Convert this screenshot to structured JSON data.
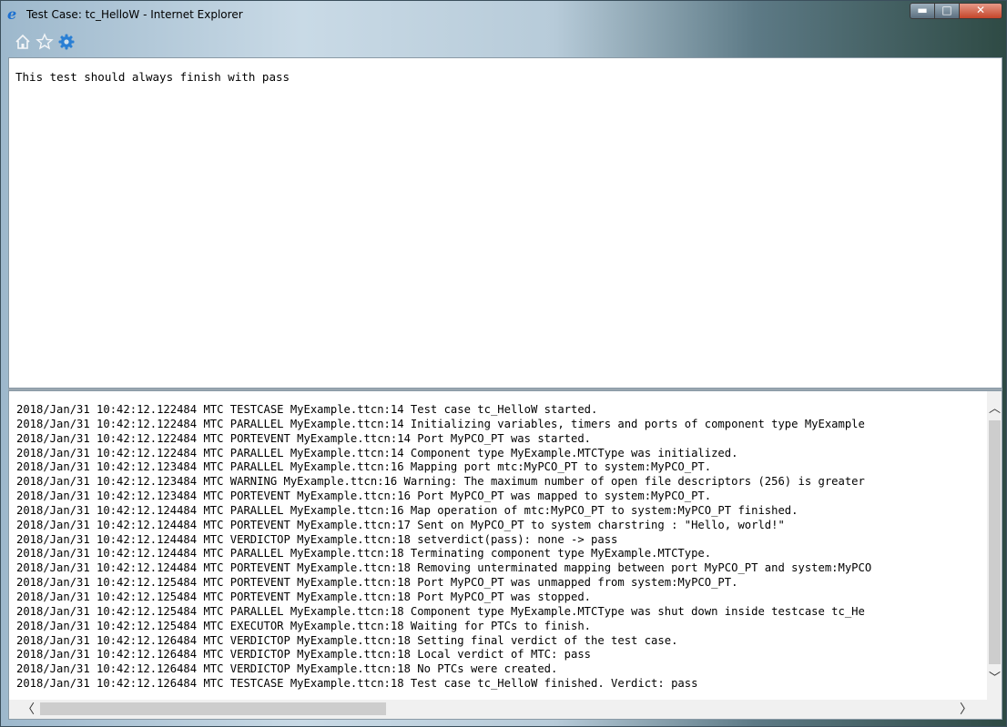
{
  "window": {
    "title": "Test Case: tc_HelloW - Internet Explorer",
    "app_icon": "internet-explorer-icon",
    "controls": {
      "minimize": "▬",
      "maximize": "□",
      "close": "✕"
    }
  },
  "toolbar": {
    "icons": [
      "home-icon",
      "star-icon",
      "gear-icon"
    ]
  },
  "description": "This test should always finish with pass",
  "log": {
    "lines": [
      "2018/Jan/31 10:42:12.122484 MTC TESTCASE MyExample.ttcn:14 Test case tc_HelloW started.",
      "2018/Jan/31 10:42:12.122484 MTC PARALLEL MyExample.ttcn:14 Initializing variables, timers and ports of component type MyExample",
      "2018/Jan/31 10:42:12.122484 MTC PORTEVENT MyExample.ttcn:14 Port MyPCO_PT was started.",
      "2018/Jan/31 10:42:12.122484 MTC PARALLEL MyExample.ttcn:14 Component type MyExample.MTCType was initialized.",
      "2018/Jan/31 10:42:12.123484 MTC PARALLEL MyExample.ttcn:16 Mapping port mtc:MyPCO_PT to system:MyPCO_PT.",
      "2018/Jan/31 10:42:12.123484 MTC WARNING MyExample.ttcn:16 Warning: The maximum number of open file descriptors (256) is greater",
      "2018/Jan/31 10:42:12.123484 MTC PORTEVENT MyExample.ttcn:16 Port MyPCO_PT was mapped to system:MyPCO_PT.",
      "2018/Jan/31 10:42:12.124484 MTC PARALLEL MyExample.ttcn:16 Map operation of mtc:MyPCO_PT to system:MyPCO_PT finished.",
      "2018/Jan/31 10:42:12.124484 MTC PORTEVENT MyExample.ttcn:17 Sent on MyPCO_PT to system charstring : \"Hello, world!\"",
      "2018/Jan/31 10:42:12.124484 MTC VERDICTOP MyExample.ttcn:18 setverdict(pass): none -> pass",
      "2018/Jan/31 10:42:12.124484 MTC PARALLEL MyExample.ttcn:18 Terminating component type MyExample.MTCType.",
      "2018/Jan/31 10:42:12.124484 MTC PORTEVENT MyExample.ttcn:18 Removing unterminated mapping between port MyPCO_PT and system:MyPCO",
      "2018/Jan/31 10:42:12.125484 MTC PORTEVENT MyExample.ttcn:18 Port MyPCO_PT was unmapped from system:MyPCO_PT.",
      "2018/Jan/31 10:42:12.125484 MTC PORTEVENT MyExample.ttcn:18 Port MyPCO_PT was stopped.",
      "2018/Jan/31 10:42:12.125484 MTC PARALLEL MyExample.ttcn:18 Component type MyExample.MTCType was shut down inside testcase tc_He",
      "2018/Jan/31 10:42:12.125484 MTC EXECUTOR MyExample.ttcn:18 Waiting for PTCs to finish.",
      "2018/Jan/31 10:42:12.126484 MTC VERDICTOP MyExample.ttcn:18 Setting final verdict of the test case.",
      "2018/Jan/31 10:42:12.126484 MTC VERDICTOP MyExample.ttcn:18 Local verdict of MTC: pass",
      "2018/Jan/31 10:42:12.126484 MTC VERDICTOP MyExample.ttcn:18 No PTCs were created.",
      "2018/Jan/31 10:42:12.126484 MTC TESTCASE MyExample.ttcn:18 Test case tc_HelloW finished. Verdict: pass"
    ]
  },
  "scrollbars": {
    "up": "︿",
    "down": "﹀",
    "left": "〈",
    "right": "〉"
  }
}
